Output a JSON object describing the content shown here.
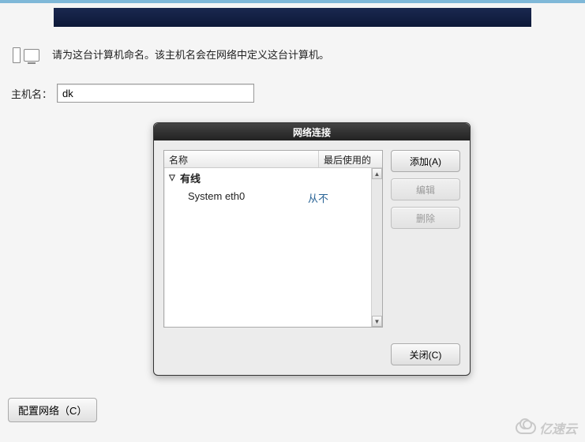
{
  "intro_text": "请为这台计算机命名。该主机名会在网络中定义这台计算机。",
  "hostname": {
    "label": "主机名：",
    "value": "dk"
  },
  "dialog": {
    "title": "网络连接",
    "columns": {
      "name": "名称",
      "last_used": "最后使用的"
    },
    "category": "有线",
    "items": [
      {
        "name": "System eth0",
        "last_used": "从不"
      }
    ],
    "buttons": {
      "add": "添加(A)",
      "edit": "编辑",
      "delete": "删除",
      "close": "关闭(C)"
    }
  },
  "config_network_button": "配置网络（C）",
  "watermark": "亿速云"
}
